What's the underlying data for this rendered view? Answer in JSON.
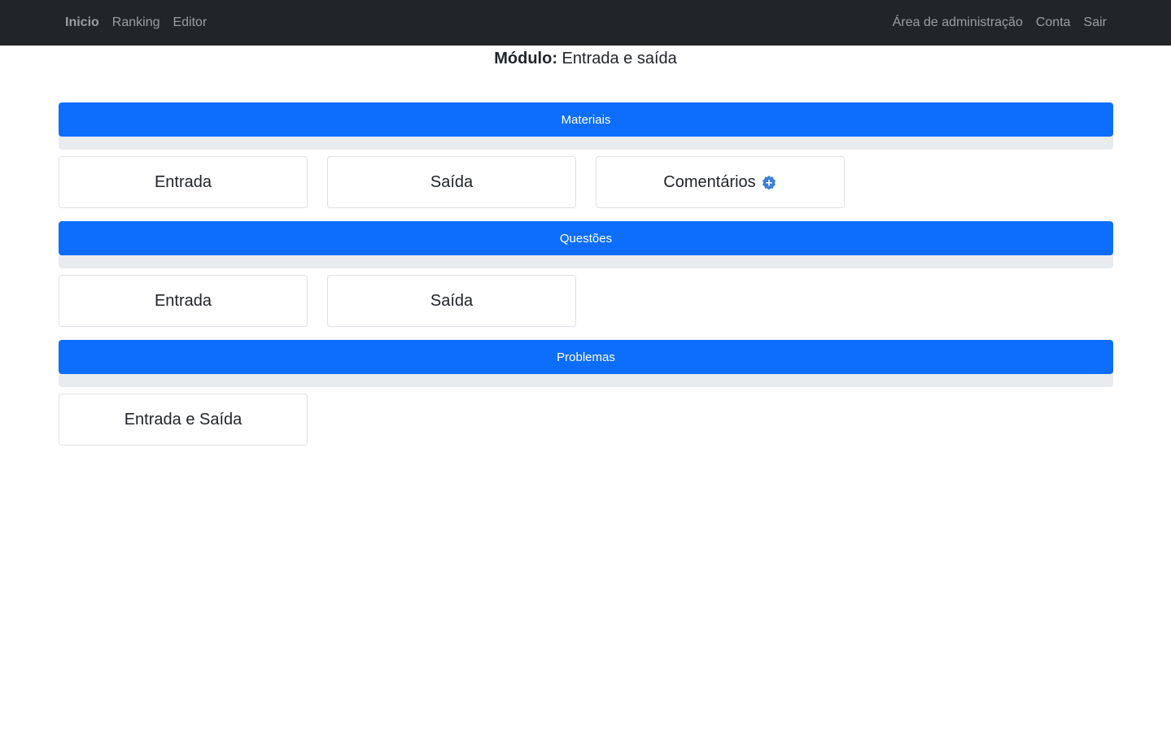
{
  "navbar": {
    "left": [
      {
        "label": "Inicio",
        "active": true
      },
      {
        "label": "Ranking"
      },
      {
        "label": "Editor"
      }
    ],
    "right": [
      {
        "label": "Área de administração"
      },
      {
        "label": "Conta"
      },
      {
        "label": "Sair"
      }
    ]
  },
  "module": {
    "label": "Módulo:",
    "name": "Entrada e saída"
  },
  "sections": [
    {
      "title": "Materiais",
      "items": [
        "Entrada",
        "Saída",
        "Comentários"
      ]
    },
    {
      "title": "Questões",
      "items": [
        "Entrada",
        "Saída"
      ]
    },
    {
      "title": "Problemas",
      "items": [
        "Entrada e Saída"
      ]
    }
  ],
  "colors": {
    "navbar_bg": "#212529",
    "accent": "#0d6efd",
    "badge": "#3b7ddd"
  },
  "icons": {
    "comentarios_badge": "plus-badge-icon"
  }
}
